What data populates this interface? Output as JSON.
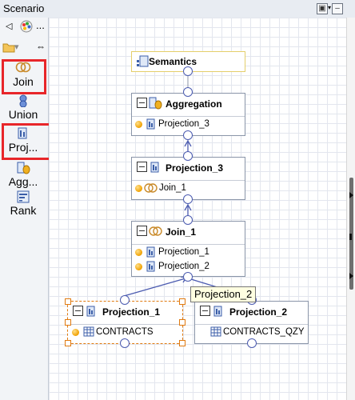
{
  "window": {
    "title": "Scenario"
  },
  "palette": {
    "expand_label": "...",
    "tools": [
      {
        "label": "Join",
        "icon": "join-icon",
        "selected": true
      },
      {
        "label": "Union",
        "icon": "union-icon",
        "selected": false
      },
      {
        "label": "Proj...",
        "icon": "projection-icon",
        "selected": true
      },
      {
        "label": "Agg...",
        "icon": "aggregation-icon",
        "selected": false
      },
      {
        "label": "Rank",
        "icon": "rank-icon",
        "selected": false
      }
    ]
  },
  "nodes": {
    "semantics": {
      "title": "Semantics"
    },
    "aggregation": {
      "title": "Aggregation",
      "inputs": [
        "Projection_3"
      ]
    },
    "projection_3": {
      "title": "Projection_3",
      "inputs": [
        "Join_1"
      ]
    },
    "join_1": {
      "title": "Join_1",
      "inputs": [
        "Projection_1",
        "Projection_2"
      ]
    },
    "projection_1": {
      "title": "Projection_1",
      "inputs": [
        "CONTRACTS"
      ]
    },
    "projection_2": {
      "title": "Projection_2",
      "inputs": [
        "CONTRACTS_QZY"
      ]
    }
  },
  "tooltip": "Projection_2",
  "colors": {
    "selection": "#e8262a",
    "link": "#4b5bb0",
    "node_border": "#8a95a8"
  }
}
